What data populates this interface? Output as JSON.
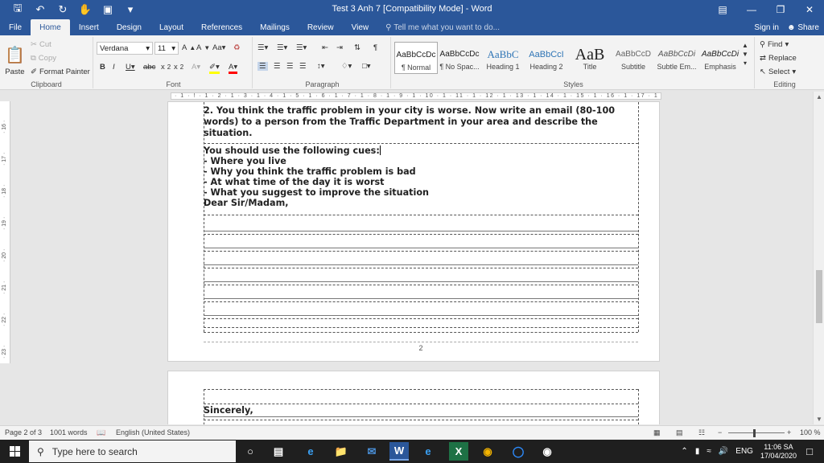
{
  "window": {
    "title": "Test 3 Anh 7 [Compatibility Mode] - Word"
  },
  "tabs": [
    "File",
    "Home",
    "Insert",
    "Design",
    "Layout",
    "References",
    "Mailings",
    "Review",
    "View"
  ],
  "tell_me": "Tell me what you want to do...",
  "sign_in": "Sign in",
  "share": "Share",
  "clipboard": {
    "cut": "Cut",
    "copy": "Copy",
    "paste": "Paste",
    "format_painter": "Format Painter",
    "label": "Clipboard"
  },
  "font": {
    "name": "Verdana",
    "size": "11",
    "label": "Font"
  },
  "paragraph": {
    "label": "Paragraph"
  },
  "styles": {
    "label": "Styles",
    "items": [
      {
        "preview": "AaBbCcDc",
        "name": "¶ Normal"
      },
      {
        "preview": "AaBbCcDc",
        "name": "¶ No Spac..."
      },
      {
        "preview": "AaBbC",
        "name": "Heading 1"
      },
      {
        "preview": "AaBbCcI",
        "name": "Heading 2"
      },
      {
        "preview": "AaB",
        "name": "Title"
      },
      {
        "preview": "AaBbCcD",
        "name": "Subtitle"
      },
      {
        "preview": "AaBbCcDi",
        "name": "Subtle Em..."
      },
      {
        "preview": "AaBbCcDi",
        "name": "Emphasis"
      }
    ]
  },
  "editing": {
    "find": "Find",
    "replace": "Replace",
    "select": "Select",
    "label": "Editing"
  },
  "document": {
    "question": [
      "2. You think the traffic problem in your city is worse. Now write an email (80-100",
      "words) to a person from the Traffic Department in your area and describe the",
      "situation."
    ],
    "cues_intro": "You should use the following cues:",
    "cues": [
      "- Where you live",
      "- Why you think the traffic problem is bad",
      "- At what time of the day it is worst",
      "- What you suggest to improve the situation"
    ],
    "greeting": "Dear Sir/Madam,",
    "page_number": "2",
    "closing": "Sincerely,"
  },
  "status": {
    "page": "Page 2 of 3",
    "words": "1001 words",
    "language": "English (United States)",
    "zoom": "100 %"
  },
  "taskbar": {
    "search_placeholder": "Type here to search",
    "language": "ENG",
    "time": "11:06 SA",
    "date": "17/04/2020"
  }
}
